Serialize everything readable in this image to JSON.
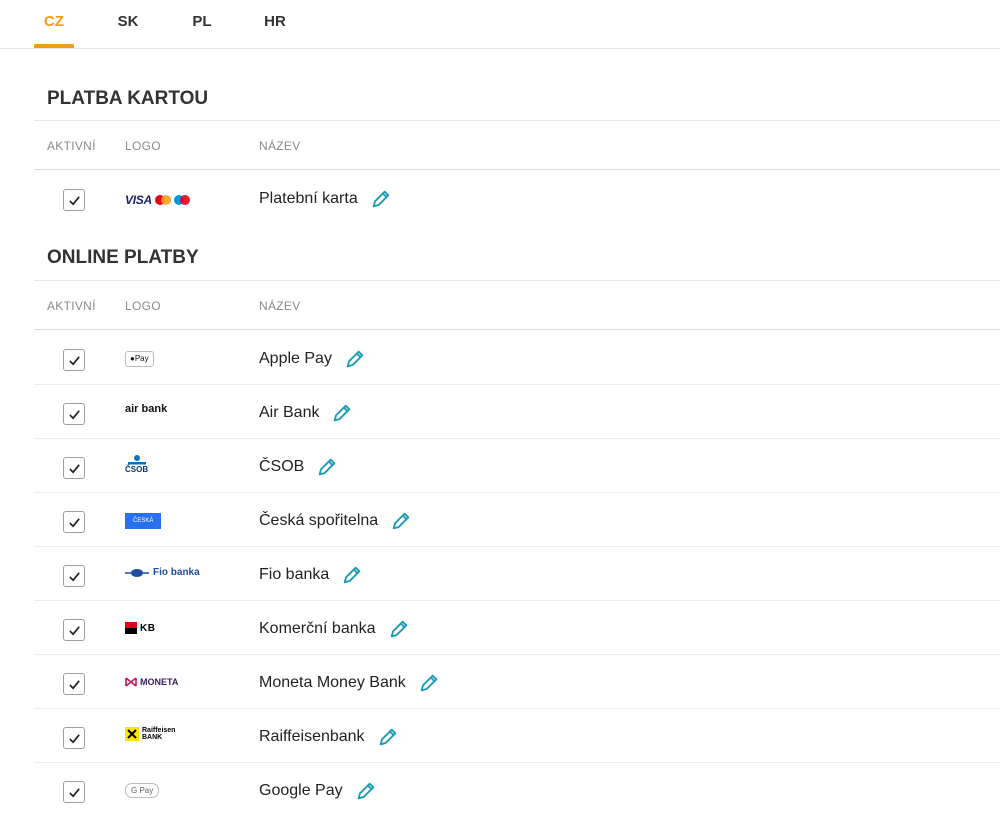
{
  "tabs": [
    {
      "label": "CZ",
      "active": true
    },
    {
      "label": "SK",
      "active": false
    },
    {
      "label": "PL",
      "active": false
    },
    {
      "label": "HR",
      "active": false
    }
  ],
  "sections": [
    {
      "title": "PLATBA KARTOU",
      "columns": {
        "active": "AKTIVNÍ",
        "logo": "LOGO",
        "name": "NÁZEV"
      },
      "rows": [
        {
          "name": "Platební karta",
          "logo": "visa-mastercard-logo",
          "logo_text": "VISA",
          "checked": true
        }
      ]
    },
    {
      "title": "ONLINE PLATBY",
      "columns": {
        "active": "AKTIVNÍ",
        "logo": "LOGO",
        "name": "NÁZEV"
      },
      "rows": [
        {
          "name": "Apple Pay",
          "logo": "apple-pay-logo",
          "logo_text": "Pay",
          "checked": true
        },
        {
          "name": "Air Bank",
          "logo": "air-bank-logo",
          "logo_text": "air bank",
          "checked": true
        },
        {
          "name": "ČSOB",
          "logo": "csob-logo",
          "logo_text": "ČSOB",
          "checked": true
        },
        {
          "name": "Česká spořitelna",
          "logo": "ceska-sporitelna-logo",
          "logo_text": "ČESKÁ",
          "checked": true
        },
        {
          "name": "Fio banka",
          "logo": "fio-banka-logo",
          "logo_text": "Fio banka",
          "checked": true
        },
        {
          "name": "Komerční banka",
          "logo": "komercni-banka-logo",
          "logo_text": "KB",
          "checked": true
        },
        {
          "name": "Moneta Money Bank",
          "logo": "moneta-logo",
          "logo_text": "MONETA",
          "checked": true
        },
        {
          "name": "Raiffeisenbank",
          "logo": "raiffeisen-logo",
          "logo_text": "Raiffeisen BANK",
          "checked": true
        },
        {
          "name": "Google Pay",
          "logo": "google-pay-logo",
          "logo_text": "G Pay",
          "checked": true
        }
      ]
    }
  ],
  "colors": {
    "accent": "#f39c12",
    "edit_icon": "#1b9bb3",
    "text": "#212121",
    "muted": "#8a8a8a"
  }
}
